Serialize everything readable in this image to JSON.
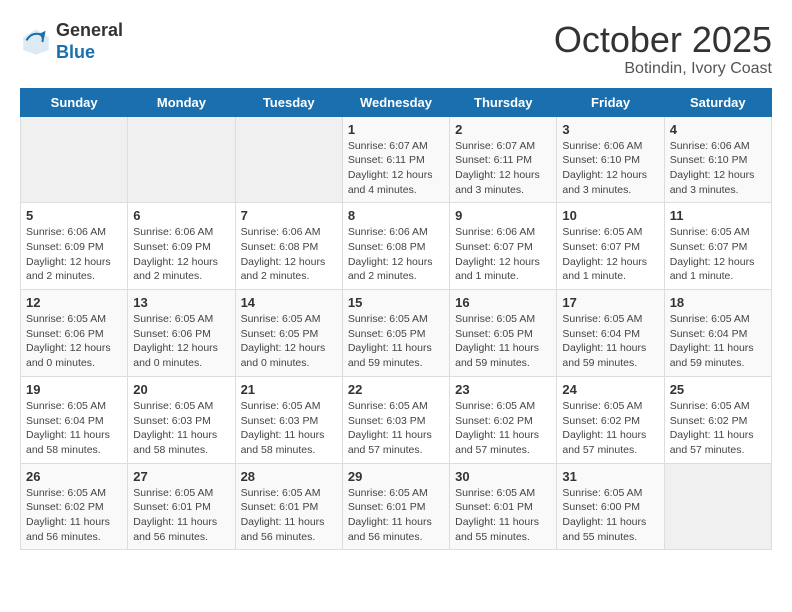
{
  "header": {
    "logo_general": "General",
    "logo_blue": "Blue",
    "title": "October 2025",
    "subtitle": "Botindin, Ivory Coast"
  },
  "days_of_week": [
    "Sunday",
    "Monday",
    "Tuesday",
    "Wednesday",
    "Thursday",
    "Friday",
    "Saturday"
  ],
  "weeks": [
    [
      {
        "day": "",
        "info": ""
      },
      {
        "day": "",
        "info": ""
      },
      {
        "day": "",
        "info": ""
      },
      {
        "day": "1",
        "info": "Sunrise: 6:07 AM\nSunset: 6:11 PM\nDaylight: 12 hours\nand 4 minutes."
      },
      {
        "day": "2",
        "info": "Sunrise: 6:07 AM\nSunset: 6:11 PM\nDaylight: 12 hours\nand 3 minutes."
      },
      {
        "day": "3",
        "info": "Sunrise: 6:06 AM\nSunset: 6:10 PM\nDaylight: 12 hours\nand 3 minutes."
      },
      {
        "day": "4",
        "info": "Sunrise: 6:06 AM\nSunset: 6:10 PM\nDaylight: 12 hours\nand 3 minutes."
      }
    ],
    [
      {
        "day": "5",
        "info": "Sunrise: 6:06 AM\nSunset: 6:09 PM\nDaylight: 12 hours\nand 2 minutes."
      },
      {
        "day": "6",
        "info": "Sunrise: 6:06 AM\nSunset: 6:09 PM\nDaylight: 12 hours\nand 2 minutes."
      },
      {
        "day": "7",
        "info": "Sunrise: 6:06 AM\nSunset: 6:08 PM\nDaylight: 12 hours\nand 2 minutes."
      },
      {
        "day": "8",
        "info": "Sunrise: 6:06 AM\nSunset: 6:08 PM\nDaylight: 12 hours\nand 2 minutes."
      },
      {
        "day": "9",
        "info": "Sunrise: 6:06 AM\nSunset: 6:07 PM\nDaylight: 12 hours\nand 1 minute."
      },
      {
        "day": "10",
        "info": "Sunrise: 6:05 AM\nSunset: 6:07 PM\nDaylight: 12 hours\nand 1 minute."
      },
      {
        "day": "11",
        "info": "Sunrise: 6:05 AM\nSunset: 6:07 PM\nDaylight: 12 hours\nand 1 minute."
      }
    ],
    [
      {
        "day": "12",
        "info": "Sunrise: 6:05 AM\nSunset: 6:06 PM\nDaylight: 12 hours\nand 0 minutes."
      },
      {
        "day": "13",
        "info": "Sunrise: 6:05 AM\nSunset: 6:06 PM\nDaylight: 12 hours\nand 0 minutes."
      },
      {
        "day": "14",
        "info": "Sunrise: 6:05 AM\nSunset: 6:05 PM\nDaylight: 12 hours\nand 0 minutes."
      },
      {
        "day": "15",
        "info": "Sunrise: 6:05 AM\nSunset: 6:05 PM\nDaylight: 11 hours\nand 59 minutes."
      },
      {
        "day": "16",
        "info": "Sunrise: 6:05 AM\nSunset: 6:05 PM\nDaylight: 11 hours\nand 59 minutes."
      },
      {
        "day": "17",
        "info": "Sunrise: 6:05 AM\nSunset: 6:04 PM\nDaylight: 11 hours\nand 59 minutes."
      },
      {
        "day": "18",
        "info": "Sunrise: 6:05 AM\nSunset: 6:04 PM\nDaylight: 11 hours\nand 59 minutes."
      }
    ],
    [
      {
        "day": "19",
        "info": "Sunrise: 6:05 AM\nSunset: 6:04 PM\nDaylight: 11 hours\nand 58 minutes."
      },
      {
        "day": "20",
        "info": "Sunrise: 6:05 AM\nSunset: 6:03 PM\nDaylight: 11 hours\nand 58 minutes."
      },
      {
        "day": "21",
        "info": "Sunrise: 6:05 AM\nSunset: 6:03 PM\nDaylight: 11 hours\nand 58 minutes."
      },
      {
        "day": "22",
        "info": "Sunrise: 6:05 AM\nSunset: 6:03 PM\nDaylight: 11 hours\nand 57 minutes."
      },
      {
        "day": "23",
        "info": "Sunrise: 6:05 AM\nSunset: 6:02 PM\nDaylight: 11 hours\nand 57 minutes."
      },
      {
        "day": "24",
        "info": "Sunrise: 6:05 AM\nSunset: 6:02 PM\nDaylight: 11 hours\nand 57 minutes."
      },
      {
        "day": "25",
        "info": "Sunrise: 6:05 AM\nSunset: 6:02 PM\nDaylight: 11 hours\nand 57 minutes."
      }
    ],
    [
      {
        "day": "26",
        "info": "Sunrise: 6:05 AM\nSunset: 6:02 PM\nDaylight: 11 hours\nand 56 minutes."
      },
      {
        "day": "27",
        "info": "Sunrise: 6:05 AM\nSunset: 6:01 PM\nDaylight: 11 hours\nand 56 minutes."
      },
      {
        "day": "28",
        "info": "Sunrise: 6:05 AM\nSunset: 6:01 PM\nDaylight: 11 hours\nand 56 minutes."
      },
      {
        "day": "29",
        "info": "Sunrise: 6:05 AM\nSunset: 6:01 PM\nDaylight: 11 hours\nand 56 minutes."
      },
      {
        "day": "30",
        "info": "Sunrise: 6:05 AM\nSunset: 6:01 PM\nDaylight: 11 hours\nand 55 minutes."
      },
      {
        "day": "31",
        "info": "Sunrise: 6:05 AM\nSunset: 6:00 PM\nDaylight: 11 hours\nand 55 minutes."
      },
      {
        "day": "",
        "info": ""
      }
    ]
  ]
}
